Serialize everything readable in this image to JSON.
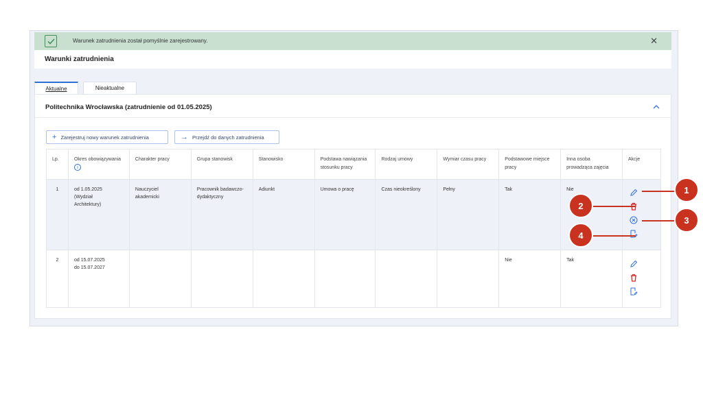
{
  "alert": {
    "message": "Warunek zatrudnienia został pomyślnie zarejestrowany.",
    "close_icon": "close-icon"
  },
  "page_title": "Warunki zatrudnienia",
  "tabs": [
    {
      "label": "Aktualne"
    },
    {
      "label": "Nieaktualne"
    }
  ],
  "card": {
    "title": "Politechnika Wrocławska (zatrudnienie od 01.05.2025)",
    "buttons": {
      "add": "Zarejestruj nowy warunek zatrudnienia",
      "goto": "Przejdź do danych zatrudnienia"
    }
  },
  "table": {
    "headers": [
      "Lp.",
      "Okres obowiązywania",
      "Charakter pracy",
      "Grupa stanowisk",
      "Stanowisko",
      "Podstawa nawiązania stosunku pracy",
      "Rodzaj umowy",
      "Wymiar czasu pracy",
      "Podstawowe miejsce pracy",
      "Inna osoba prowadząca zajęcia",
      "Akcje"
    ],
    "rows": [
      {
        "lp": "1",
        "okres_1": "od 1.05.2025",
        "okres_2": "(Wydział",
        "okres_3": "Architektury)",
        "charakter_1": "Nauczyciel",
        "charakter_2": "akademicki",
        "grupa_1": "Pracownik badawczo-",
        "grupa_2": "dydaktyczny",
        "stanowisko": "Adiunkt",
        "podstawa": "Umowa o pracę",
        "rodzaj": "Czas nieokreślony",
        "wymiar": "Pełny",
        "miejsce": "Tak",
        "inna": "Nie"
      },
      {
        "lp": "2",
        "okres_1": "od 15.07.2025",
        "okres_2": "do 15.07.2027",
        "miejsce": "Nie",
        "inna": "Tak"
      }
    ]
  },
  "callouts": [
    "1",
    "2",
    "3",
    "4"
  ],
  "colors": {
    "accent": "#2f6fd8",
    "danger": "#d62828",
    "callout": "#c8321f",
    "success_bg": "#c9e0d1"
  }
}
